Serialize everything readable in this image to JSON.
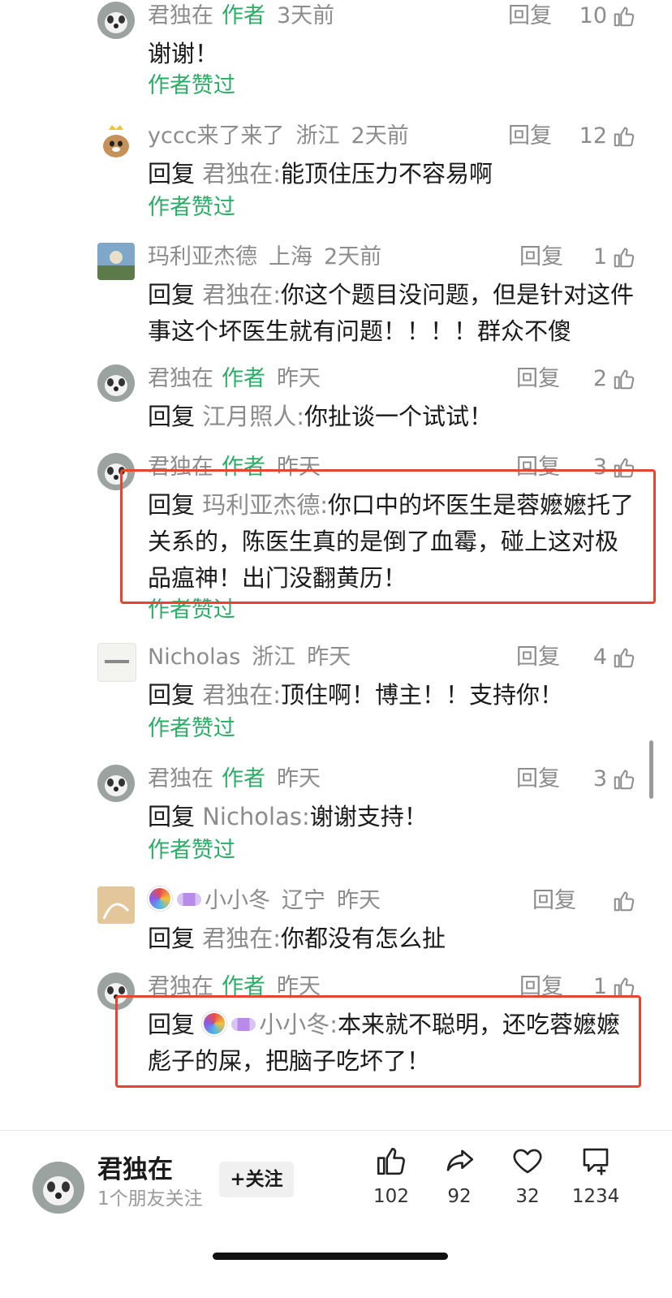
{
  "comments": [
    {
      "user": "君独在",
      "is_author": true,
      "author_tag": "作者",
      "location": "",
      "time": "3天前",
      "reply_label": "回复",
      "likes": "10",
      "prefix": "",
      "target": "",
      "sep": "",
      "text": "谢谢！",
      "liked": "作者赞过"
    },
    {
      "user": "yccc来了来了",
      "is_author": false,
      "author_tag": "",
      "location": "浙江",
      "time": "2天前",
      "reply_label": "回复",
      "likes": "12",
      "prefix": "回复",
      "target": "君独在",
      "sep": ":",
      "text": "能顶住压力不容易啊",
      "liked": "作者赞过"
    },
    {
      "user": "玛利亚杰德",
      "is_author": false,
      "author_tag": "",
      "location": "上海",
      "time": "2天前",
      "reply_label": "回复",
      "likes": "1",
      "prefix": "回复",
      "target": "君独在",
      "sep": ":",
      "text": "你这个题目没问题，但是针对这件事这个坏医生就有问题！！！！群众不傻",
      "liked": ""
    },
    {
      "user": "君独在",
      "is_author": true,
      "author_tag": "作者",
      "location": "",
      "time": "昨天",
      "reply_label": "回复",
      "likes": "2",
      "prefix": "回复",
      "target": "江月照人",
      "sep": ":",
      "text": "你扯谈一个试试！",
      "liked": ""
    },
    {
      "user": "君独在",
      "is_author": true,
      "author_tag": "作者",
      "location": "",
      "time": "昨天",
      "reply_label": "回复",
      "likes": "3",
      "prefix": "回复",
      "target": "玛利亚杰德",
      "sep": ":",
      "text": "你口中的坏医生是蓉嬷嬷托了关系的，陈医生真的是倒了血霉，碰上这对极品瘟神！出门没翻黄历！",
      "liked": "作者赞过"
    },
    {
      "user": "Nicholas",
      "is_author": false,
      "author_tag": "",
      "location": "浙江",
      "time": "昨天",
      "reply_label": "回复",
      "likes": "4",
      "prefix": "回复",
      "target": "君独在",
      "sep": ":",
      "text": "顶住啊！博主！！支持你！",
      "liked": "作者赞过"
    },
    {
      "user": "君独在",
      "is_author": true,
      "author_tag": "作者",
      "location": "",
      "time": "昨天",
      "reply_label": "回复",
      "likes": "3",
      "prefix": "回复",
      "target": "Nicholas",
      "sep": ":",
      "text": "谢谢支持！",
      "liked": "作者赞过"
    },
    {
      "user": "小小冬",
      "is_author": false,
      "author_tag": "",
      "location": "辽宁",
      "time": "昨天",
      "reply_label": "回复",
      "likes": "",
      "prefix": "回复",
      "target": "君独在",
      "sep": ":",
      "text": "你都没有怎么扯",
      "liked": ""
    },
    {
      "user": "君独在",
      "is_author": true,
      "author_tag": "作者",
      "location": "",
      "time": "昨天",
      "reply_label": "回复",
      "likes": "1",
      "prefix": "回复",
      "target": "小小冬",
      "sep": ":",
      "text": "本来就不聪明，还吃蓉嬷嬷彪子的屎，把脑子吃坏了！",
      "liked": ""
    }
  ],
  "footer": {
    "name": "君独在",
    "friends": "1个朋友关注",
    "follow_label": "+关注",
    "like_count": "102",
    "share_count": "92",
    "fav_count": "32",
    "comment_count": "1234"
  },
  "colors": {
    "author_green": "#2aae67",
    "highlight_red": "#e8442e",
    "meta_gray": "#8c8c8c"
  }
}
